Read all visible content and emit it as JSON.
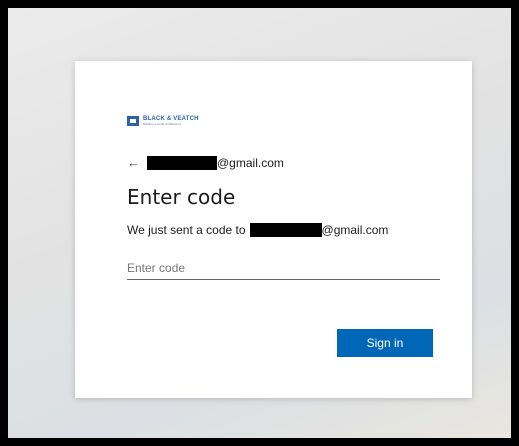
{
  "logo": {
    "name": "BLACK & VEATCH",
    "tagline": "Building a world of difference"
  },
  "identity": {
    "back_arrow": "←",
    "email_suffix": "@gmail.com"
  },
  "page": {
    "title": "Enter code",
    "message_prefix": "We just sent a code to",
    "message_suffix": "@gmail.com"
  },
  "form": {
    "code_placeholder": "Enter code",
    "code_value": "",
    "submit_label": "Sign in"
  },
  "colors": {
    "primary_button": "#0067b8",
    "brand": "#2f5fa8"
  }
}
